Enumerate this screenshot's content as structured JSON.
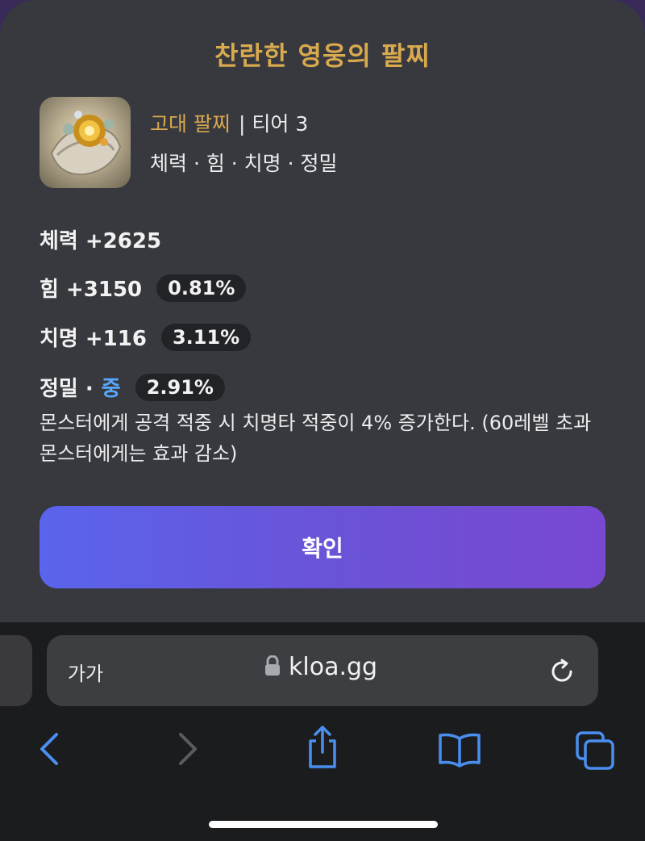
{
  "modal": {
    "title": "찬란한 영웅의 팔찌",
    "item": {
      "grade": "고대 팔찌",
      "tier": "| 티어 3",
      "stats_summary": "체력 · 힘 · 치명 · 정밀"
    },
    "stats": [
      {
        "label": "체력 +2625"
      },
      {
        "label": "힘 +3150",
        "percent": "0.81%"
      },
      {
        "label": "치명 +116",
        "percent": "3.11%"
      },
      {
        "label": "정밀 ·",
        "level": "중",
        "percent": "2.91%"
      }
    ],
    "description": "몬스터에게 공격 적중 시 치명타 적중이 4% 증가한다. (60레벨 초과 몬스터에게는 효과 감소)",
    "confirm_label": "확인"
  },
  "browser": {
    "text_size_label": "가가",
    "url": "kloa.gg"
  },
  "colors": {
    "accent_gold": "#d9a94e",
    "level_blue": "#58a8ff",
    "button_gradient_start": "#5a64ec",
    "button_gradient_end": "#7948d2",
    "browser_icon_blue": "#4a8ff0"
  },
  "icons": [
    "lock-icon",
    "reload-icon",
    "back-icon",
    "forward-icon",
    "share-icon",
    "bookmarks-icon",
    "tabs-icon"
  ]
}
